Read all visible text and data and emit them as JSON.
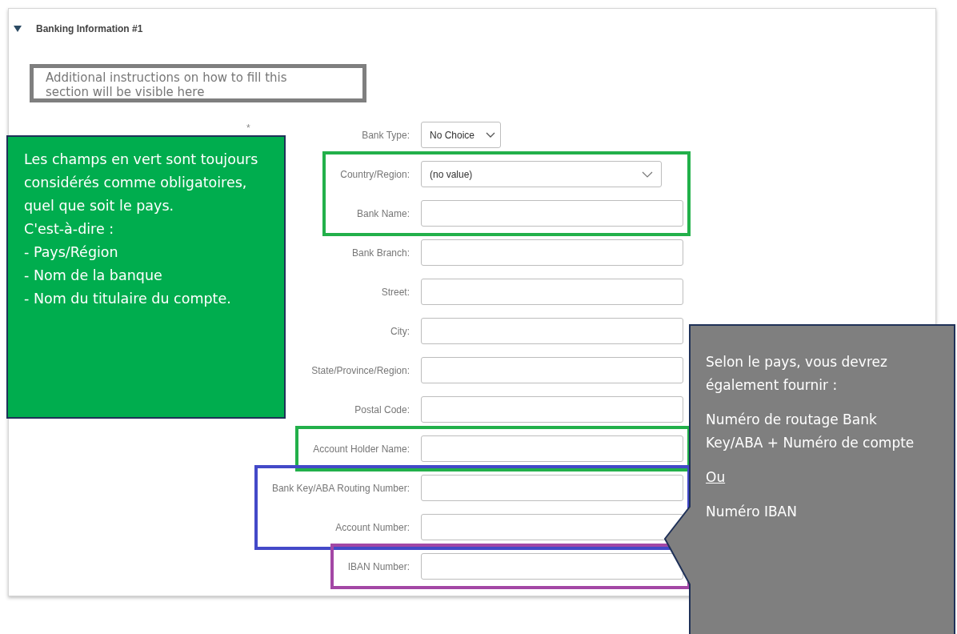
{
  "section": {
    "title": "Banking Information #1",
    "expanded": true
  },
  "instructions": "Additional instructions on how to fill this section will be visible here",
  "required_mark": "*",
  "groups": [
    {
      "fields": [
        {
          "label": "Bank Type:",
          "kind": "dropdown-small",
          "value": "No Choice"
        }
      ]
    },
    {
      "color": "#22b04a",
      "fields": [
        {
          "label": "Country/Region:",
          "kind": "dropdown",
          "value": "(no value)"
        },
        {
          "label": "Bank Name:",
          "kind": "text"
        }
      ]
    },
    {
      "fields": [
        {
          "label": "Bank Branch:",
          "kind": "text"
        },
        {
          "label": "Street:",
          "kind": "text"
        },
        {
          "label": "City:",
          "kind": "text"
        },
        {
          "label": "State/Province/Region:",
          "kind": "text"
        },
        {
          "label": "Postal Code:",
          "kind": "text"
        }
      ]
    },
    {
      "color": "#22b04a",
      "fields": [
        {
          "label": "Account Holder Name:",
          "kind": "text"
        }
      ]
    },
    {
      "color": "#4349c8",
      "fields": [
        {
          "label": "Bank Key/ABA Routing Number:",
          "kind": "text"
        },
        {
          "label": "Account Number:",
          "kind": "text"
        }
      ]
    },
    {
      "color": "#a347a5",
      "fields": [
        {
          "label": "IBAN Number:",
          "kind": "text"
        }
      ]
    }
  ],
  "green_note": {
    "lines": [
      "Les champs en vert sont toujours considérés comme obligatoires, quel que soit le pays.",
      "C'est-à-dire :",
      "- Pays/Région",
      "- Nom de la banque",
      "- Nom du titulaire du compte."
    ]
  },
  "grey_note": {
    "paragraphs": [
      {
        "text": "Selon le pays, vous devrez également fournir :",
        "underline": false
      },
      {
        "text": "Numéro de routage Bank Key/ABA + Numéro de compte",
        "underline": false
      },
      {
        "text": "Ou",
        "underline": true
      },
      {
        "text": "Numéro IBAN",
        "underline": false
      }
    ]
  }
}
